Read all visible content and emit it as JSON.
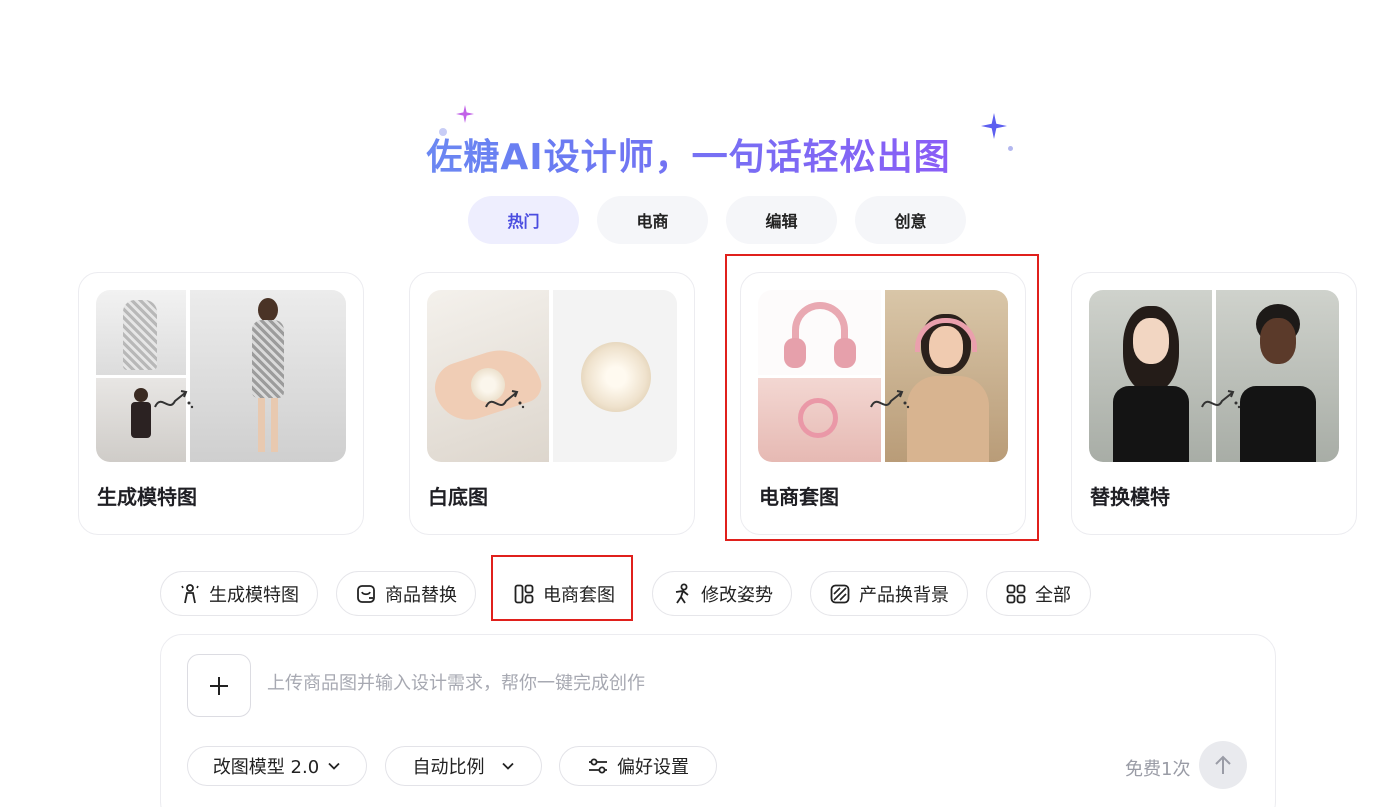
{
  "hero": {
    "title": "佐糖AI设计师，一句话轻松出图"
  },
  "tabs": [
    {
      "label": "热门",
      "active": true
    },
    {
      "label": "电商",
      "active": false
    },
    {
      "label": "编辑",
      "active": false
    },
    {
      "label": "创意",
      "active": false
    }
  ],
  "cards": [
    {
      "title": "生成模特图"
    },
    {
      "title": "白底图"
    },
    {
      "title": "电商套图",
      "highlighted": true
    },
    {
      "title": "替换模特"
    }
  ],
  "quick_tools": [
    {
      "label": "生成模特图",
      "icon": "model-figure-icon"
    },
    {
      "label": "商品替换",
      "icon": "product-swap-icon"
    },
    {
      "label": "电商套图",
      "icon": "grid-set-icon",
      "highlighted": true
    },
    {
      "label": "修改姿势",
      "icon": "pose-icon"
    },
    {
      "label": "产品换背景",
      "icon": "background-icon"
    },
    {
      "label": "全部",
      "icon": "all-apps-icon"
    }
  ],
  "composer": {
    "placeholder": "上传商品图并输入设计需求，帮你一键完成创作",
    "model_label": "改图模型 2.0",
    "ratio_label": "自动比例",
    "prefs_label": "偏好设置",
    "free_label": "免费1次"
  },
  "colors": {
    "accent": "#4b4de0",
    "highlight_border": "#e0201c",
    "tab_active_bg": "#eeeefe"
  }
}
